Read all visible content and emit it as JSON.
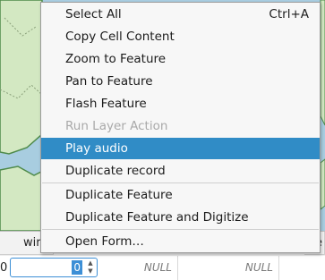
{
  "menu": {
    "items": [
      {
        "label": "Select All",
        "shortcut": "Ctrl+A",
        "state": "normal"
      },
      {
        "label": "Copy Cell Content",
        "shortcut": "",
        "state": "normal"
      },
      {
        "label": "Zoom to Feature",
        "shortcut": "",
        "state": "normal"
      },
      {
        "label": "Pan to Feature",
        "shortcut": "",
        "state": "normal"
      },
      {
        "label": "Flash Feature",
        "shortcut": "",
        "state": "normal"
      },
      {
        "label": "Run Layer Action",
        "shortcut": "",
        "state": "disabled"
      },
      {
        "label": "Play audio",
        "shortcut": "",
        "state": "selected"
      },
      {
        "label": "Duplicate record",
        "shortcut": "",
        "state": "normal"
      },
      {
        "label": "Duplicate Feature",
        "shortcut": "",
        "state": "normal"
      },
      {
        "label": "Duplicate Feature and Digitize",
        "shortcut": "",
        "state": "normal"
      },
      {
        "label": "Open Form…",
        "shortcut": "",
        "state": "normal"
      }
    ]
  },
  "table": {
    "header_partial_left": "wir",
    "header_partial_right": "e",
    "row_number": "0",
    "edit_value": "0",
    "spin_up": "▲",
    "spin_down": "▼",
    "null_1": "NULL",
    "null_2": "NULL"
  },
  "colors": {
    "selection": "#308cc6",
    "water": "#a8cde0",
    "land": "#d3e8c2",
    "border": "#4e8a4a"
  }
}
